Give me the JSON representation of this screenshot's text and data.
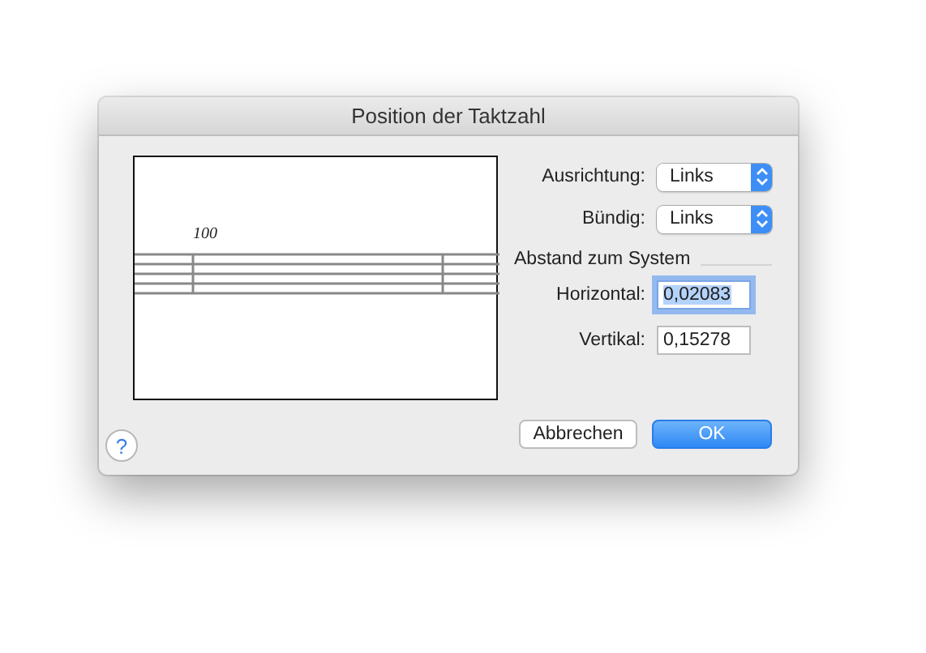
{
  "window": {
    "title": "Position der Taktzahl"
  },
  "preview": {
    "measure_number": "100"
  },
  "selects": [
    {
      "label": "Ausrichtung:",
      "value": "Links"
    },
    {
      "label": "Bündig:",
      "value": "Links"
    }
  ],
  "distance": {
    "heading": "Abstand zum System",
    "fields": [
      {
        "label": "Horizontal:",
        "value": "0,02083",
        "focused": true
      },
      {
        "label": "Vertikal:",
        "value": "0,15278",
        "focused": false
      }
    ]
  },
  "help": {
    "label": "?"
  },
  "buttons": [
    {
      "label": "Abbrechen",
      "kind": "cancel"
    },
    {
      "label": "OK",
      "kind": "default"
    }
  ]
}
